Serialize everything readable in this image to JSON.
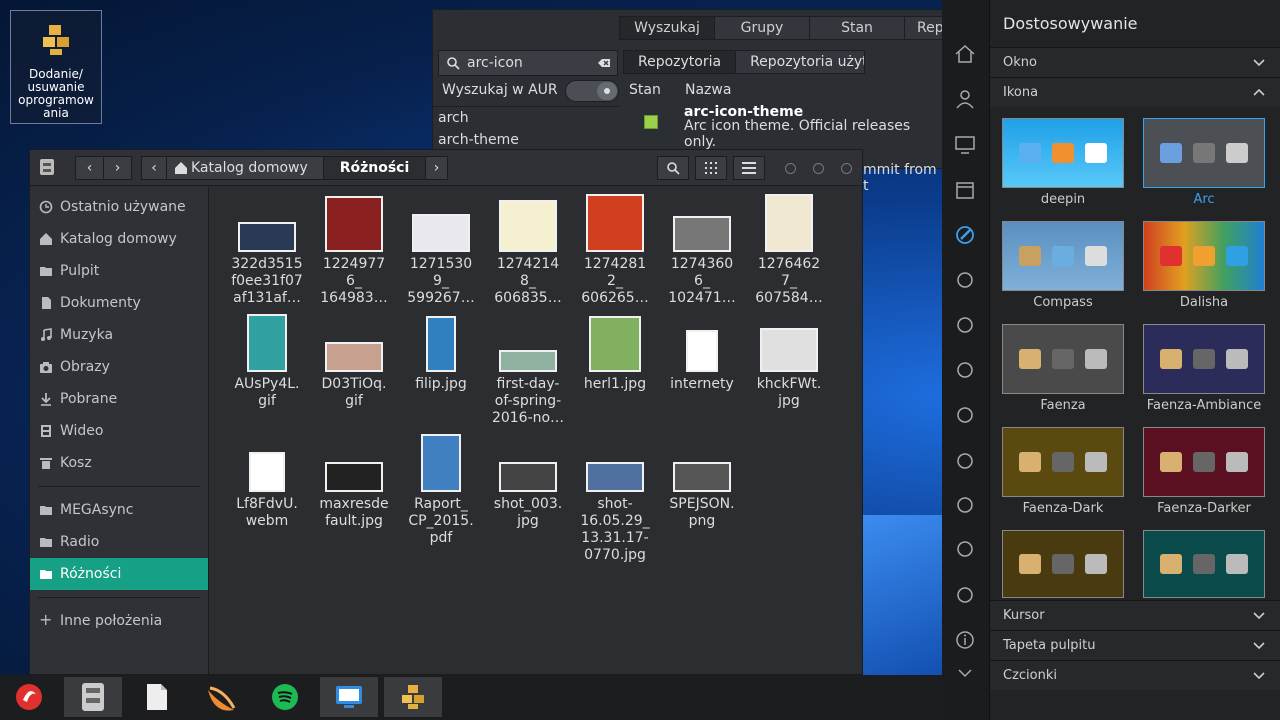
{
  "desktop": {
    "icon_label": "Dodanie/\nusuwanie\noprogramow\nania",
    "icon_lines": [
      "Dodanie/",
      "usuwanie",
      "oprogramow",
      "ania"
    ]
  },
  "pamac": {
    "tabs": [
      "Wyszukaj",
      "Grupy",
      "Stan",
      "Repo"
    ],
    "search_value": "arc-icon",
    "aur_label": "Wyszukaj w AUR",
    "left_list": [
      "arch",
      "arch-theme"
    ],
    "subtabs": [
      "Repozytoria",
      "Repozytoria użytkowników Ar"
    ],
    "col_state": "Stan",
    "col_name": "Nazwa",
    "package_name": "arc-icon-theme",
    "package_desc": "Arc icon theme. Official releases only.",
    "commit_text": "mmit from t"
  },
  "filemanager": {
    "breadcrumb_home": "Katalog domowy",
    "breadcrumb_current": "Różności",
    "sidebar": [
      {
        "label": "Ostatnio używane",
        "icon": "clock-icon"
      },
      {
        "label": "Katalog domowy",
        "icon": "home-icon"
      },
      {
        "label": "Pulpit",
        "icon": "folder-icon"
      },
      {
        "label": "Dokumenty",
        "icon": "document-icon"
      },
      {
        "label": "Muzyka",
        "icon": "music-icon"
      },
      {
        "label": "Obrazy",
        "icon": "camera-icon"
      },
      {
        "label": "Pobrane",
        "icon": "download-icon"
      },
      {
        "label": "Wideo",
        "icon": "film-icon"
      },
      {
        "label": "Kosz",
        "icon": "trash-icon"
      }
    ],
    "sidebar2": [
      {
        "label": "MEGAsync",
        "icon": "folder-icon"
      },
      {
        "label": "Radio",
        "icon": "folder-icon"
      },
      {
        "label": "Różności",
        "icon": "folder-icon"
      }
    ],
    "other_locations": "Inne położenia",
    "files": [
      {
        "name": "322d3515\nf0ee31f07\naf131af…"
      },
      {
        "name": "1224977\n6_\n164983…"
      },
      {
        "name": "1271530\n9_\n599267…"
      },
      {
        "name": "1274214\n8_\n606835…"
      },
      {
        "name": "1274281\n2_\n606265…"
      },
      {
        "name": "1274360\n6_\n102471…"
      },
      {
        "name": "1276462\n7_\n607584…"
      },
      {
        "name": "AUsPy4L.\ngif"
      },
      {
        "name": "D03TiOq.\ngif"
      },
      {
        "name": "filip.jpg"
      },
      {
        "name": "first-day-\nof-spring-\n2016-no…"
      },
      {
        "name": "herl1.jpg"
      },
      {
        "name": "internety"
      },
      {
        "name": "khckFWt.\njpg"
      },
      {
        "name": "Lf8FdvU.\nwebm"
      },
      {
        "name": "maxresde\nfault.jpg"
      },
      {
        "name": "Raport_\nCP_2015.\npdf"
      },
      {
        "name": "shot_003.\njpg"
      },
      {
        "name": "shot-\n16.05.29_\n13.31.17-\n0770.jpg"
      },
      {
        "name": "SPEJSON.\npng"
      }
    ]
  },
  "panel": {
    "title": "Dostosowywanie",
    "sections": {
      "window": "Okno",
      "icon": "Ikona",
      "cursor": "Kursor",
      "wallpaper": "Tapeta pulpitu",
      "fonts": "Czcionki"
    },
    "themes": [
      "deepin",
      "Arc",
      "Compass",
      "Dalisha",
      "Faenza",
      "Faenza-Ambiance",
      "Faenza-Dark",
      "Faenza-Darker",
      "",
      ""
    ],
    "selected_theme": "Arc",
    "colors": {
      "accent": "#3aa0f0",
      "selection": "#16a085"
    }
  },
  "taskbar": {
    "apps": [
      "launcher-icon",
      "file-manager-icon",
      "text-editor-icon",
      "orange-app-icon",
      "spotify-icon",
      "remote-desktop-icon",
      "software-manager-icon"
    ]
  }
}
